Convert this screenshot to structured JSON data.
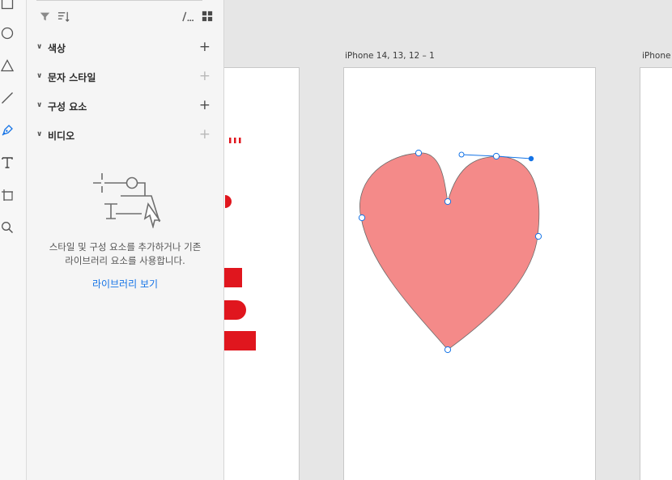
{
  "toolbar": {
    "tools": [
      {
        "name": "rectangle-tool"
      },
      {
        "name": "ellipse-tool"
      },
      {
        "name": "polygon-tool"
      },
      {
        "name": "line-tool"
      },
      {
        "name": "pen-tool",
        "active": true
      },
      {
        "name": "text-tool"
      },
      {
        "name": "artboard-tool"
      },
      {
        "name": "zoom-tool"
      }
    ]
  },
  "assets_panel": {
    "header_icons": [
      "filter-icon",
      "sort-icon",
      "list-view-icon",
      "grid-view-icon"
    ],
    "sections": [
      {
        "label": "색상",
        "add_enabled": true
      },
      {
        "label": "문자 스타일",
        "add_enabled": false
      },
      {
        "label": "구성 요소",
        "add_enabled": true
      },
      {
        "label": "비디오",
        "add_enabled": false
      }
    ],
    "empty_state": {
      "line1": "스타일 및 구성 요소를 추가하거나 기존",
      "line2": "라이브러리 요소를 사용합니다.",
      "link": "라이브러리 보기"
    }
  },
  "canvas": {
    "artboards": [
      {
        "label": "iPhone 14, 13, 12 – 1"
      },
      {
        "label": "iPhone"
      }
    ],
    "heart": {
      "fill": "#f48a89",
      "stroke": "#6b6b6b"
    },
    "selection_color": "#1473e6",
    "partial_artboard_accent": "#e0161e"
  }
}
